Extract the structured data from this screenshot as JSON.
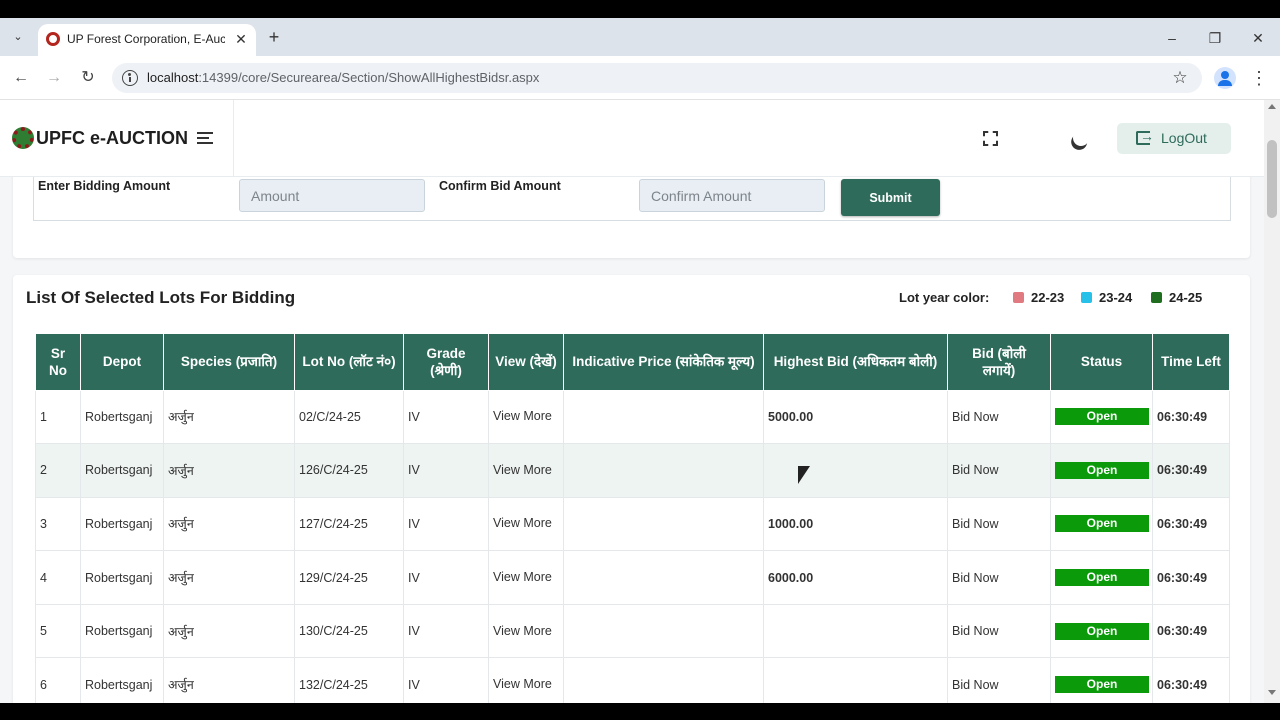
{
  "browser": {
    "tab_title": "UP Forest Corporation, E-Auction",
    "url_host": "localhost",
    "url_rest": ":14399/core/Securearea/Section/ShowAllHighestBidsr.aspx"
  },
  "header": {
    "brand": "UPFC e-AUCTION",
    "logout_label": "LogOut"
  },
  "bid_form": {
    "amount_label": "Enter Bidding Amount",
    "amount_placeholder": "Amount",
    "confirm_label": "Confirm Bid Amount",
    "confirm_placeholder": "Confirm Amount",
    "submit_label": "Submit"
  },
  "lots": {
    "title": "List Of Selected Lots For Bidding",
    "legend_title": "Lot year color:",
    "legend": [
      {
        "label": "22-23",
        "color": "#e07a80"
      },
      {
        "label": "23-24",
        "color": "#27c0e8"
      },
      {
        "label": "24-25",
        "color": "#1f6e1f"
      }
    ],
    "columns": [
      "Sr No",
      "Depot",
      "Species (प्रजाति)",
      "Lot No (लॉट नं०)",
      "Grade (श्रेणी)",
      "View (देखें)",
      "Indicative Price (सांकेतिक मूल्य)",
      "Highest Bid (अधिकतम बोली)",
      "Bid (बोली लगायें)",
      "Status",
      "Time Left"
    ],
    "rows": [
      {
        "sr": "1",
        "depot": "Robertsganj",
        "species": "अर्जुन",
        "lot": "02/C/24-25",
        "grade": "IV",
        "view": "View More",
        "price": "",
        "highest": "5000.00",
        "bid": "Bid Now",
        "status": "Open",
        "time": "06:30:49"
      },
      {
        "sr": "2",
        "depot": "Robertsganj",
        "species": "अर्जुन",
        "lot": "126/C/24-25",
        "grade": "IV",
        "view": "View More",
        "price": "",
        "highest": "",
        "bid": "Bid Now",
        "status": "Open",
        "time": "06:30:49"
      },
      {
        "sr": "3",
        "depot": "Robertsganj",
        "species": "अर्जुन",
        "lot": "127/C/24-25",
        "grade": "IV",
        "view": "View More",
        "price": "",
        "highest": "1000.00",
        "bid": "Bid Now",
        "status": "Open",
        "time": "06:30:49"
      },
      {
        "sr": "4",
        "depot": "Robertsganj",
        "species": "अर्जुन",
        "lot": "129/C/24-25",
        "grade": "IV",
        "view": "View More",
        "price": "",
        "highest": "6000.00",
        "bid": "Bid Now",
        "status": "Open",
        "time": "06:30:49"
      },
      {
        "sr": "5",
        "depot": "Robertsganj",
        "species": "अर्जुन",
        "lot": "130/C/24-25",
        "grade": "IV",
        "view": "View More",
        "price": "",
        "highest": "",
        "bid": "Bid Now",
        "status": "Open",
        "time": "06:30:49"
      },
      {
        "sr": "6",
        "depot": "Robertsganj",
        "species": "अर्जुन",
        "lot": "132/C/24-25",
        "grade": "IV",
        "view": "View More",
        "price": "",
        "highest": "",
        "bid": "Bid Now",
        "status": "Open",
        "time": "06:30:49"
      }
    ]
  }
}
